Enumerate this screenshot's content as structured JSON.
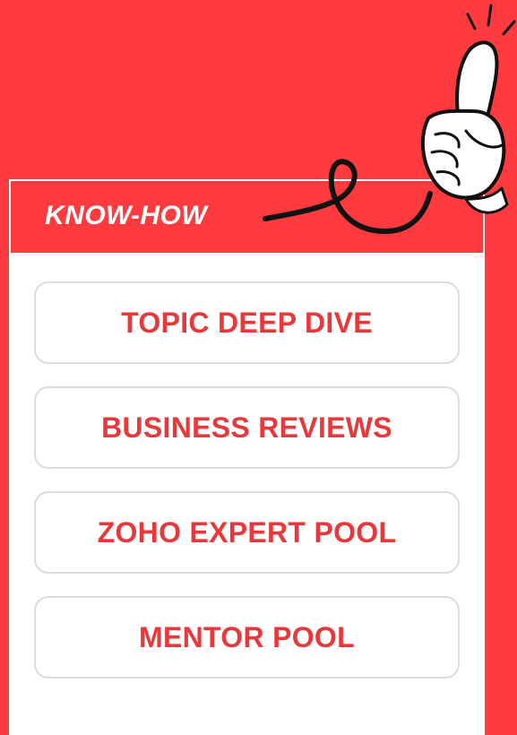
{
  "section": {
    "title": "KNOW-HOW"
  },
  "items": [
    {
      "label": "TOPIC DEEP DIVE"
    },
    {
      "label": "BUSINESS REVIEWS"
    },
    {
      "label": "ZOHO EXPERT POOL"
    },
    {
      "label": "MENTOR POOL"
    }
  ],
  "colors": {
    "background": "#FF3B3F",
    "accent_text": "#E8383B",
    "card_border": "#DCDCDC"
  },
  "icons": {
    "hand": "pointing-hand-icon",
    "squiggle": "squiggle-line-icon"
  }
}
